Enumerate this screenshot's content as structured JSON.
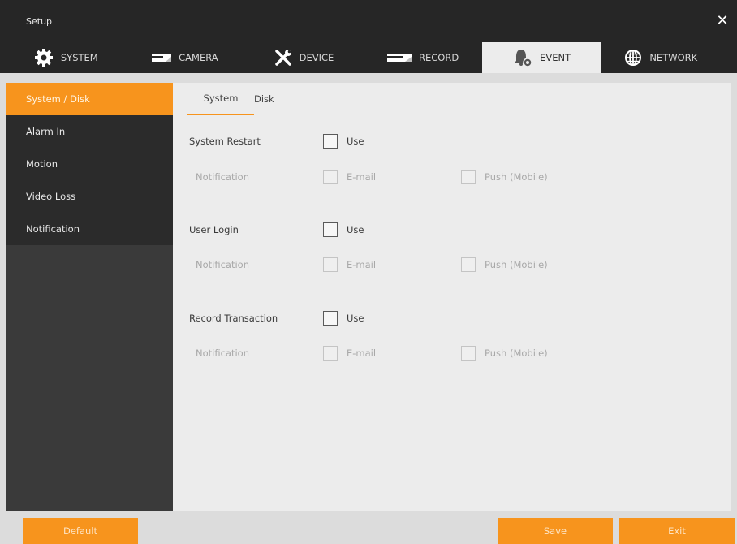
{
  "window": {
    "title": "Setup",
    "close_label": "✕"
  },
  "tabs": [
    {
      "label": "SYSTEM",
      "icon": "gear-icon"
    },
    {
      "label": "CAMERA",
      "icon": "camera-icon"
    },
    {
      "label": "DEVICE",
      "icon": "tools-icon"
    },
    {
      "label": "RECORD",
      "icon": "record-icon"
    },
    {
      "label": "EVENT",
      "icon": "bell-icon",
      "active": true
    },
    {
      "label": "NETWORK",
      "icon": "globe-icon"
    }
  ],
  "sidebar": {
    "items": [
      {
        "label": "System / Disk",
        "active": true
      },
      {
        "label": "Alarm In"
      },
      {
        "label": "Motion"
      },
      {
        "label": "Video Loss"
      },
      {
        "label": "Notification"
      }
    ]
  },
  "subtabs": [
    {
      "label": "System",
      "active": true
    },
    {
      "label": "Disk"
    }
  ],
  "sections": [
    {
      "label": "System Restart",
      "use_label": "Use",
      "use_checked": false,
      "notification_label": "Notification",
      "email_label": "E-mail",
      "push_label": "Push (Mobile)"
    },
    {
      "label": "User Login",
      "use_label": "Use",
      "use_checked": false,
      "notification_label": "Notification",
      "email_label": "E-mail",
      "push_label": "Push (Mobile)"
    },
    {
      "label": "Record Transaction",
      "use_label": "Use",
      "use_checked": false,
      "notification_label": "Notification",
      "email_label": "E-mail",
      "push_label": "Push (Mobile)"
    }
  ],
  "buttons": {
    "default_label": "Default",
    "save_label": "Save",
    "exit_label": "Exit"
  },
  "colors": {
    "accent": "#f7941d",
    "frame": "#262626",
    "sidebar": "#2b2b2b",
    "content": "#ececec"
  }
}
